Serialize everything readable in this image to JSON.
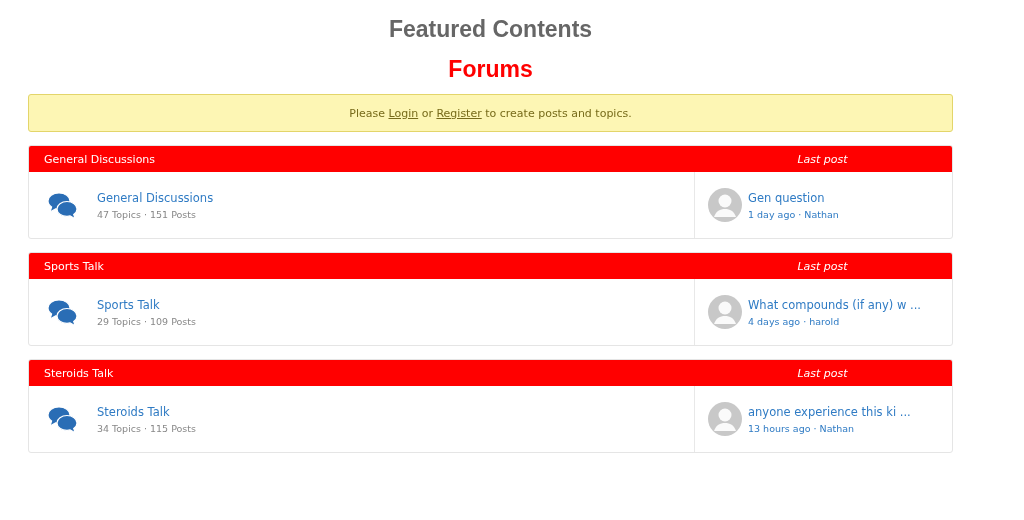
{
  "heading": "Featured Contents",
  "subheading": "Forums",
  "notice": {
    "before": "Please",
    "login": "Login",
    "middle": "or",
    "register": "Register",
    "after": "to create posts and topics."
  },
  "categories": [
    {
      "title": "General Discussions",
      "last_post_label": "Last post",
      "forum": {
        "name": "General Discussions",
        "stats": "47 Topics · 151 Posts"
      },
      "last_post": {
        "topic": "Gen question",
        "meta": "1 day ago · Nathan"
      }
    },
    {
      "title": "Sports Talk",
      "last_post_label": "Last post",
      "forum": {
        "name": "Sports Talk",
        "stats": "29 Topics · 109 Posts"
      },
      "last_post": {
        "topic": "What compounds (if any) w ...",
        "meta": "4 days ago · harold"
      }
    },
    {
      "title": "Steroids Talk",
      "last_post_label": "Last post",
      "forum": {
        "name": "Steroids Talk",
        "stats": "34 Topics · 115 Posts"
      },
      "last_post": {
        "topic": "anyone experience this ki ...",
        "meta": "13 hours ago · Nathan"
      }
    }
  ]
}
